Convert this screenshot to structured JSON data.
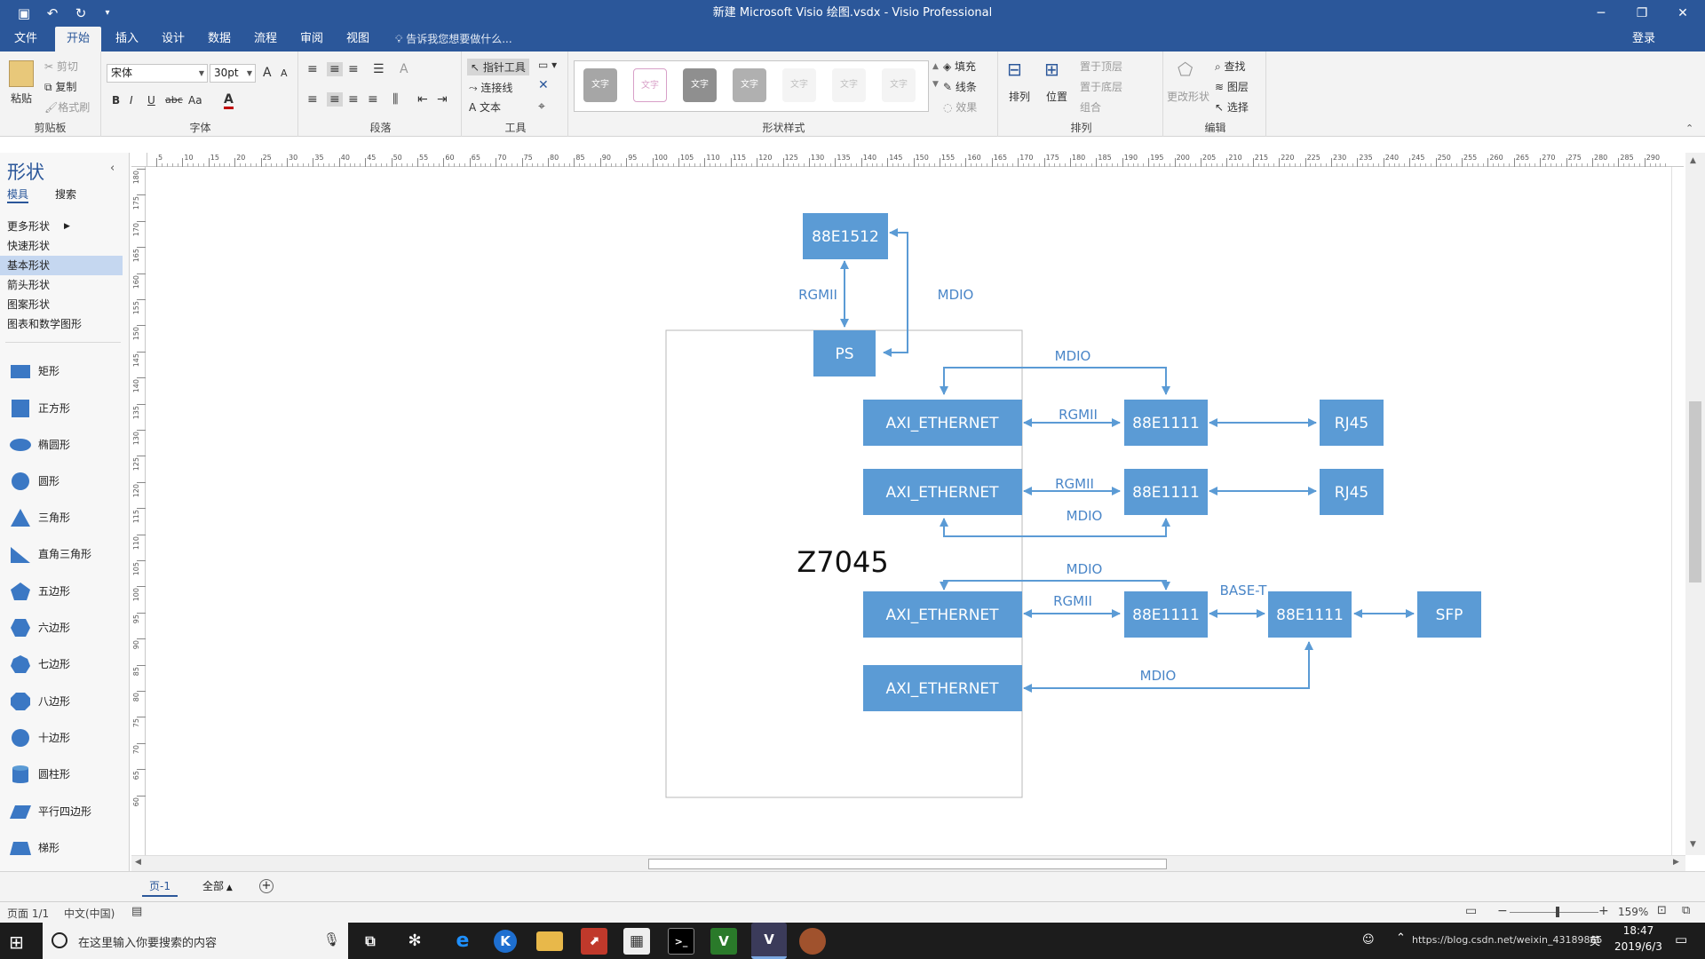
{
  "window": {
    "title": "新建 Microsoft Visio 绘图.vsdx - Visio Professional",
    "minimize_icon": "─",
    "restore_icon": "❐",
    "close_icon": "✕"
  },
  "ribbon_tabs": [
    "文件",
    "开始",
    "插入",
    "设计",
    "数据",
    "流程",
    "审阅",
    "视图"
  ],
  "active_tab": "开始",
  "tell_me": "告诉我您想要做什么...",
  "login": "登录",
  "ribbon": {
    "clipboard": {
      "paste": "粘贴",
      "cut": "剪切",
      "copy": "复制",
      "format_painter": "格式刷",
      "label": "剪贴板"
    },
    "font": {
      "name": "宋体",
      "size": "30pt",
      "grow": "A",
      "shrink": "A",
      "bold": "B",
      "italic": "I",
      "underline": "U",
      "strike": "abc",
      "case": "Aa",
      "color": "A",
      "label": "字体"
    },
    "paragraph": {
      "label": "段落"
    },
    "tools": {
      "pointer": "指针工具",
      "connector": "连接线",
      "text": "文本",
      "label": "工具"
    },
    "styles": {
      "swatch_text": "文字",
      "label": "形状样式"
    },
    "fill": {
      "fill": "填充",
      "line": "线条",
      "effects": "效果"
    },
    "arrange": {
      "arrange": "排列",
      "position": "位置",
      "bring_front": "置于顶层",
      "send_back": "置于底层",
      "group": "组合",
      "label": "排列"
    },
    "editing": {
      "change_shape": "更改形状",
      "find": "查找",
      "layers": "图层",
      "select": "选择",
      "label": "编辑"
    }
  },
  "sidebar": {
    "title": "形状",
    "collapse": "‹",
    "tabs": [
      "模具",
      "搜索"
    ],
    "categories": [
      "更多形状",
      "快速形状",
      "基本形状",
      "箭头形状",
      "图案形状",
      "图表和数学图形"
    ],
    "selected_category": "基本形状",
    "shapes": [
      "矩形",
      "正方形",
      "椭圆形",
      "圆形",
      "三角形",
      "直角三角形",
      "五边形",
      "六边形",
      "七边形",
      "八边形",
      "十边形",
      "圆柱形",
      "平行四边形",
      "梯形"
    ]
  },
  "ruler": {
    "top_labels": [
      "5",
      "10",
      "15",
      "20",
      "25",
      "30",
      "35",
      "40",
      "45",
      "50",
      "55",
      "60",
      "65",
      "70",
      "75",
      "80",
      "85",
      "90",
      "95",
      "100",
      "105",
      "110",
      "115",
      "120",
      "125",
      "130",
      "135",
      "140",
      "145",
      "150",
      "155",
      "160",
      "165",
      "170",
      "175",
      "180",
      "185",
      "190",
      "195",
      "200",
      "205",
      "210",
      "215",
      "220",
      "225",
      "230",
      "235",
      "240",
      "245",
      "250",
      "255",
      "260",
      "265",
      "270",
      "275",
      "280",
      "285",
      "290"
    ],
    "left_labels": [
      "180",
      "175",
      "170",
      "165",
      "160",
      "155",
      "150",
      "145",
      "140",
      "135",
      "130",
      "125",
      "120",
      "115",
      "110",
      "105",
      "100",
      "95",
      "90",
      "85",
      "80",
      "75",
      "70",
      "65",
      "60"
    ]
  },
  "diagram": {
    "colors": {
      "box": "#5b9bd5",
      "arrow": "#5b9bd5",
      "label": "#4a86c8",
      "container_border": "#b8b8b8"
    },
    "container_label": "Z7045",
    "boxes": {
      "phy_top": "88E1512",
      "ps": "PS",
      "axi1": "AXI_ETHERNET",
      "axi2": "AXI_ETHERNET",
      "axi3": "AXI_ETHERNET",
      "axi4": "AXI_ETHERNET",
      "phy1": "88E1111",
      "phy2": "88E1111",
      "phy3": "88E1111",
      "phy4": "88E1111",
      "rj45_1": "RJ45",
      "rj45_2": "RJ45",
      "sfp": "SFP"
    },
    "labels": {
      "rgmii_top": "RGMII",
      "mdio_top": "MDIO",
      "mdio_1": "MDIO",
      "rgmii_1": "RGMII",
      "rgmii_2": "RGMII",
      "mdio_2": "MDIO",
      "mdio_3": "MDIO",
      "rgmii_3": "RGMII",
      "base_t": "BASE-T",
      "mdio_4": "MDIO"
    }
  },
  "pages": {
    "current": "页-1",
    "all": "全部",
    "add": "+"
  },
  "status": {
    "page": "页面 1/1",
    "language": "中文(中国)",
    "zoom": "159%"
  },
  "taskbar": {
    "search_placeholder": "在这里输入你要搜索的内容",
    "time": "18:47",
    "date": "2019/6/3",
    "tray_text": "https://blog.csdn.net/weixin_43189865",
    "ime": "英"
  }
}
